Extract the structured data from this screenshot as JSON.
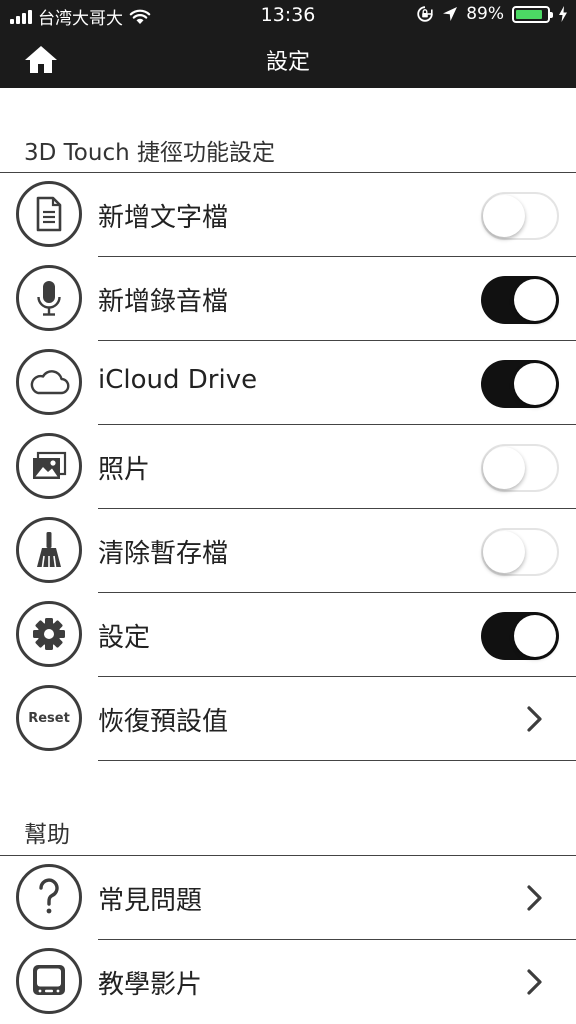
{
  "status_bar": {
    "carrier": "台湾大哥大",
    "time": "13:36",
    "battery_percent": "89%",
    "battery_level": 0.89
  },
  "nav": {
    "title": "設定",
    "home_icon": "home-icon"
  },
  "sections": [
    {
      "header": "3D Touch 捷徑功能設定",
      "items": [
        {
          "label": "新增文字檔",
          "icon": "document-icon",
          "control": "toggle",
          "on": false
        },
        {
          "label": "新增錄音檔",
          "icon": "microphone-icon",
          "control": "toggle",
          "on": true
        },
        {
          "label": "iCloud Drive",
          "icon": "cloud-icon",
          "control": "toggle",
          "on": true
        },
        {
          "label": "照片",
          "icon": "photos-icon",
          "control": "toggle",
          "on": false
        },
        {
          "label": "清除暫存檔",
          "icon": "broom-icon",
          "control": "toggle",
          "on": false
        },
        {
          "label": "設定",
          "icon": "gear-icon",
          "control": "toggle",
          "on": true
        },
        {
          "label": "恢復預設值",
          "icon": "reset-icon",
          "icon_text": "Reset",
          "control": "chevron"
        }
      ]
    },
    {
      "header": "幫助",
      "items": [
        {
          "label": "常見問題",
          "icon": "question-icon",
          "control": "chevron"
        },
        {
          "label": "教學影片",
          "icon": "video-tutorial-icon",
          "control": "chevron"
        }
      ]
    }
  ]
}
